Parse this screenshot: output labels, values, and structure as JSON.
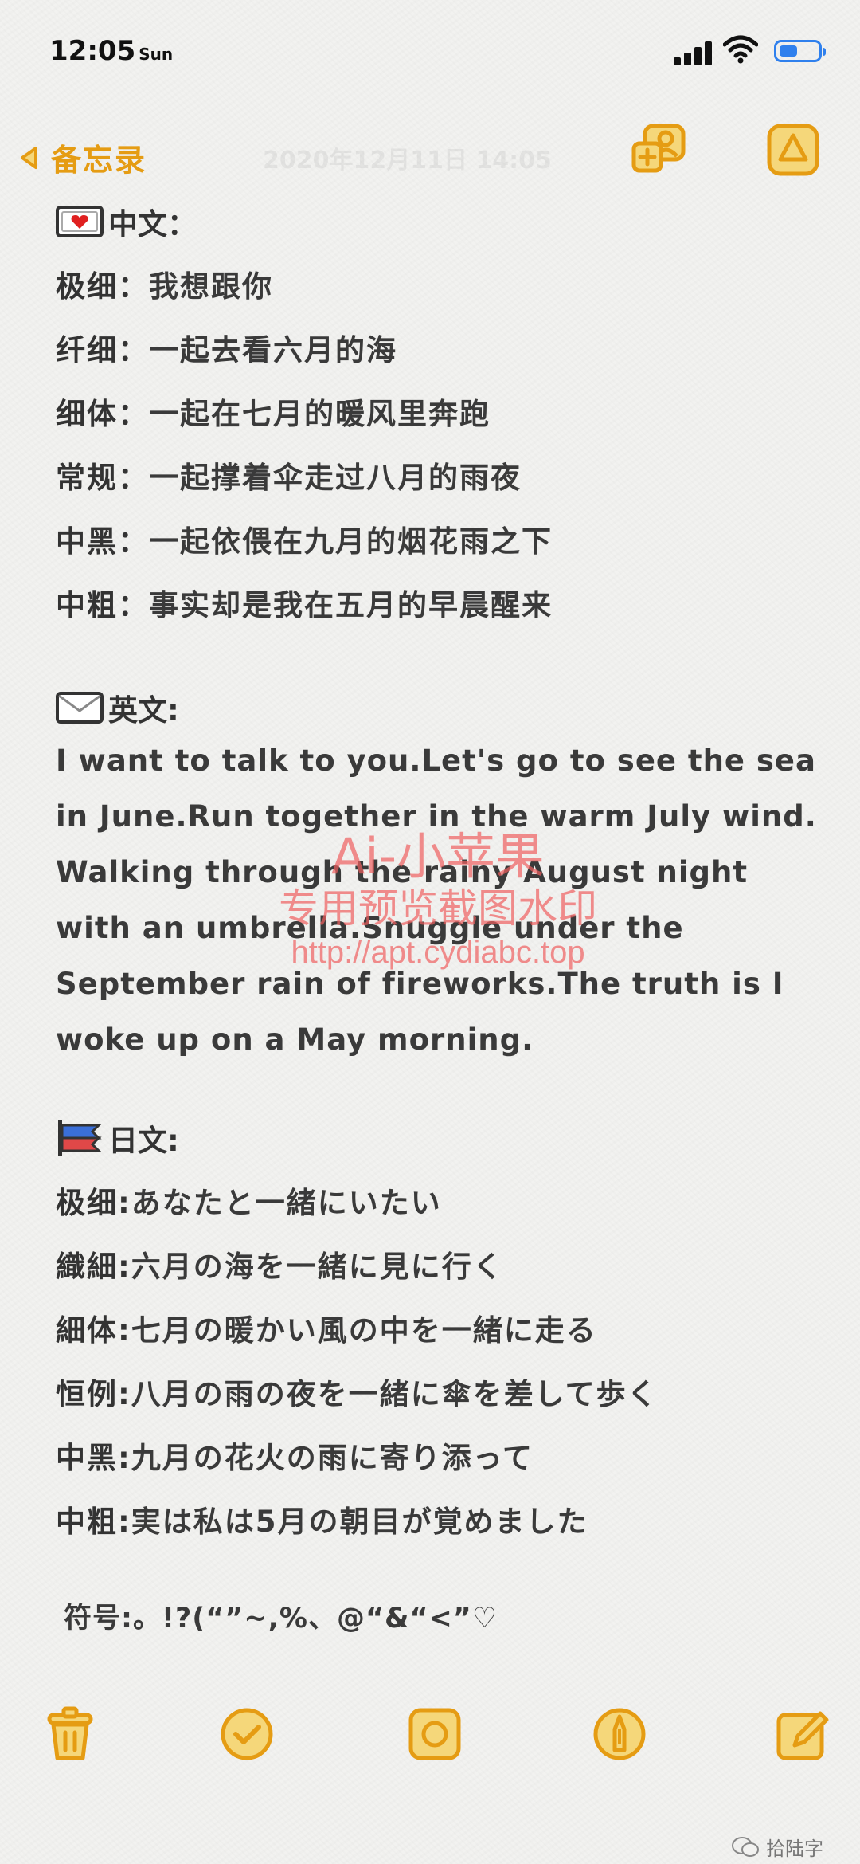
{
  "status": {
    "time": "12:05",
    "day": "Sun"
  },
  "nav": {
    "back_label": "备忘录",
    "datetime": "2020年12月11日 14:05"
  },
  "sections": {
    "chinese": {
      "heading": "中文：",
      "lines": [
        {
          "label": "极细：",
          "text": "我想跟你"
        },
        {
          "label": "纤细：",
          "text": "一起去看六月的海"
        },
        {
          "label": "细体：",
          "text": "一起在七月的暖风里奔跑"
        },
        {
          "label": "常规：",
          "text": "一起撑着伞走过八月的雨夜"
        },
        {
          "label": "中黑：",
          "text": "一起依偎在九月的烟花雨之下"
        },
        {
          "label": "中粗：",
          "text": "事实却是我在五月的早晨醒来"
        }
      ]
    },
    "english": {
      "heading": "英文:",
      "paragraph": "I want to talk to you.Let's go to see the sea in June.Run together in the warm July wind. Walking through the rainy August night with an umbrella.Snuggle under the September rain of fireworks.The truth is I woke up on a May morning."
    },
    "japanese": {
      "heading": "日文:",
      "lines": [
        {
          "label": "极细:",
          "text": "あなたと一緒にいたい"
        },
        {
          "label": "織細:",
          "text": "六月の海を一緒に見に行く"
        },
        {
          "label": "細体:",
          "text": "七月の暖かい風の中を一緒に走る"
        },
        {
          "label": "恒例:",
          "text": "八月の雨の夜を一緒に傘を差して歩く"
        },
        {
          "label": "中黑:",
          "text": "九月の花火の雨に寄り添って"
        },
        {
          "label": "中粗:",
          "text": "実は私は5月の朝目が覚めました"
        }
      ]
    },
    "symbols": "符号:。!?(“”~,%、@“&“<”♡"
  },
  "watermark": {
    "line1": "Ai-小苹果",
    "line2": "专用预览截图水印",
    "line3": "http://apt.cydiabc.top"
  },
  "footer": {
    "wechat": "拾陆字"
  },
  "colors": {
    "accent": "#e59c13",
    "accent_fill": "#f5d77a",
    "text": "#3a3a3a",
    "watermark": "#f05f5f"
  },
  "icons": {
    "back": "chevron-left-icon",
    "add_people": "add-people-icon",
    "share": "share-icon",
    "delete": "trash-icon",
    "checklist": "checkmark-icon",
    "camera": "camera-icon",
    "markup": "pen-icon",
    "compose": "compose-icon"
  }
}
